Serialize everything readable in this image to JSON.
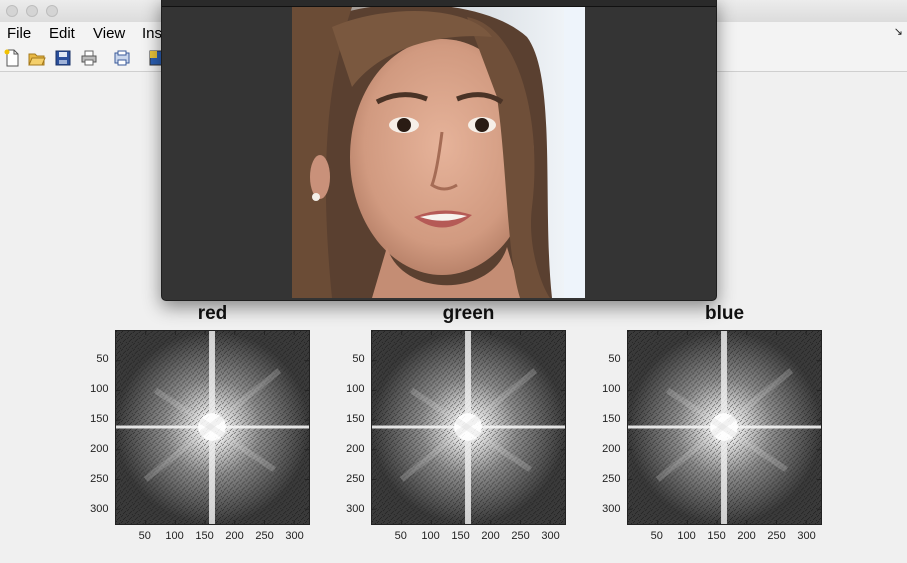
{
  "menubar": {
    "items": [
      {
        "label": "File",
        "left": 7
      },
      {
        "label": "Edit",
        "left": 49
      },
      {
        "label": "View",
        "left": 93
      },
      {
        "label": "Ins",
        "left": 142
      }
    ],
    "corner_glyph": "↘"
  },
  "toolbar": {
    "buttons": [
      "new-file-icon",
      "open-folder-icon",
      "save-icon",
      "print-icon",
      "print-preview-icon",
      "colormap-icon"
    ]
  },
  "image_window": {
    "photo_description_icon": "portrait-photo"
  },
  "plots": [
    {
      "title": "red"
    },
    {
      "title": "green"
    },
    {
      "title": "blue"
    }
  ],
  "axes": {
    "y_ticks": [
      "50",
      "100",
      "150",
      "200",
      "250",
      "300"
    ],
    "x_ticks": [
      "50",
      "100",
      "150",
      "200",
      "250",
      "300"
    ]
  }
}
